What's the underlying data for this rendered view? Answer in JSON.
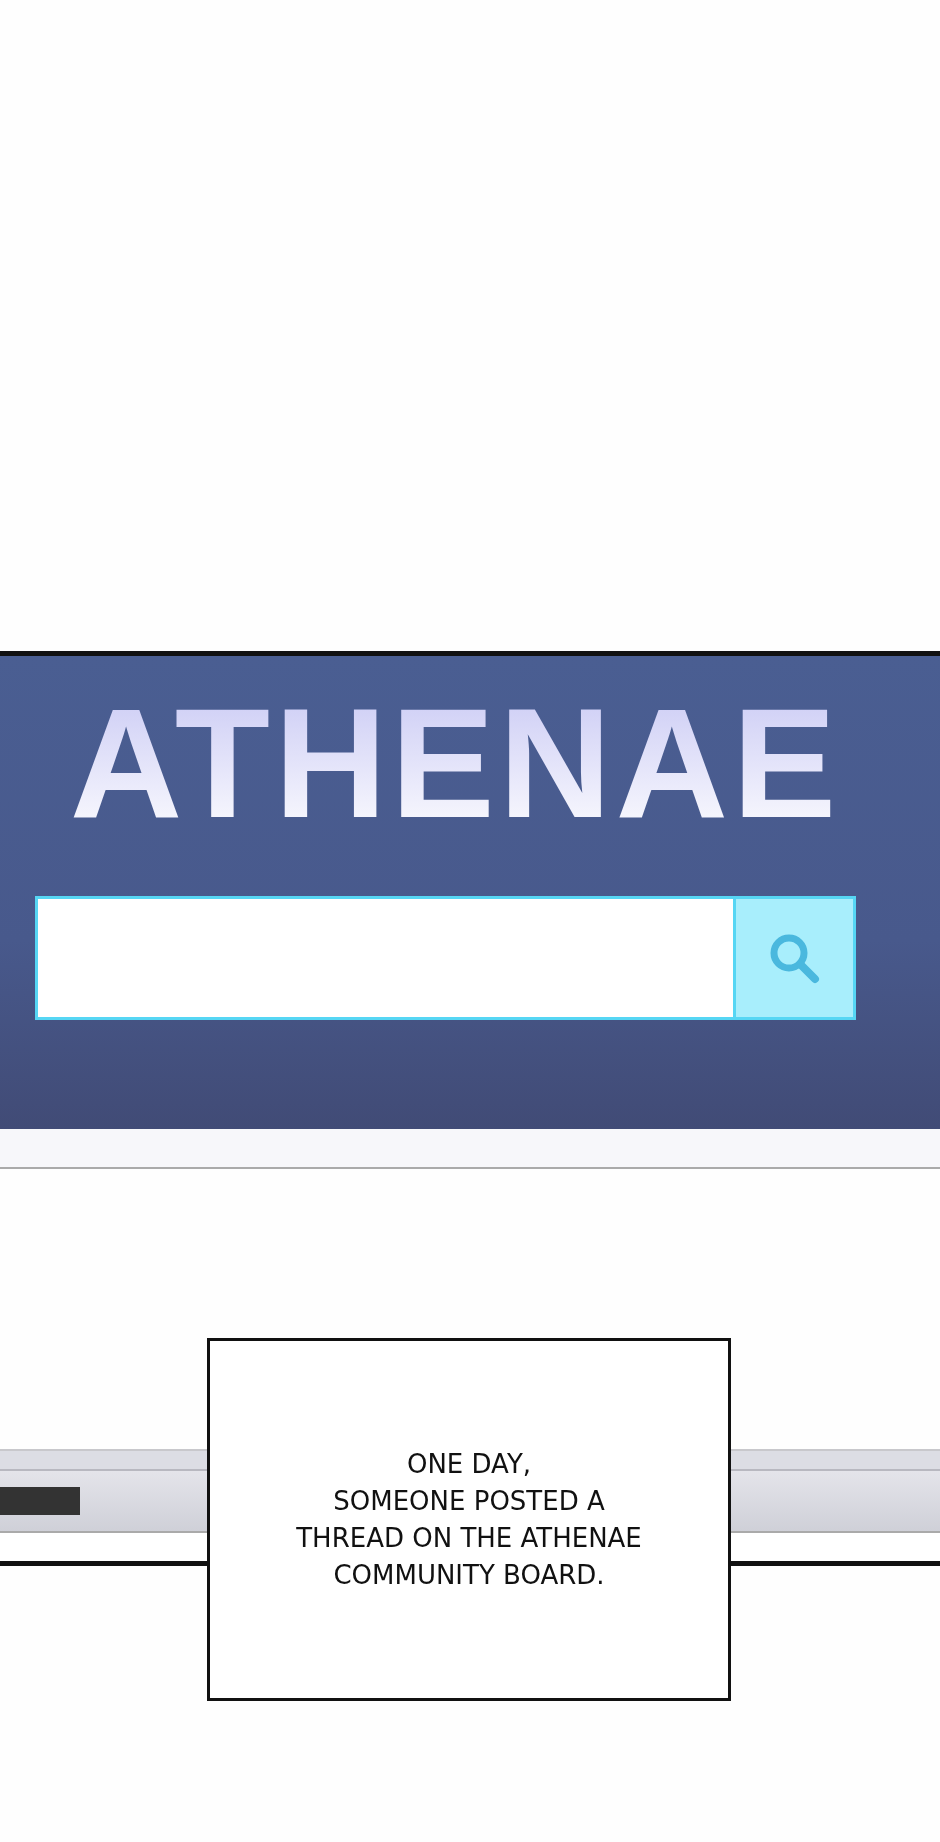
{
  "site": {
    "logo": "ATHENAE"
  },
  "caption": {
    "lines": [
      "ONE DAY,",
      "SOMEONE POSTED A",
      "THREAD ON THE ATHENAE",
      "COMMUNITY BOARD."
    ]
  }
}
